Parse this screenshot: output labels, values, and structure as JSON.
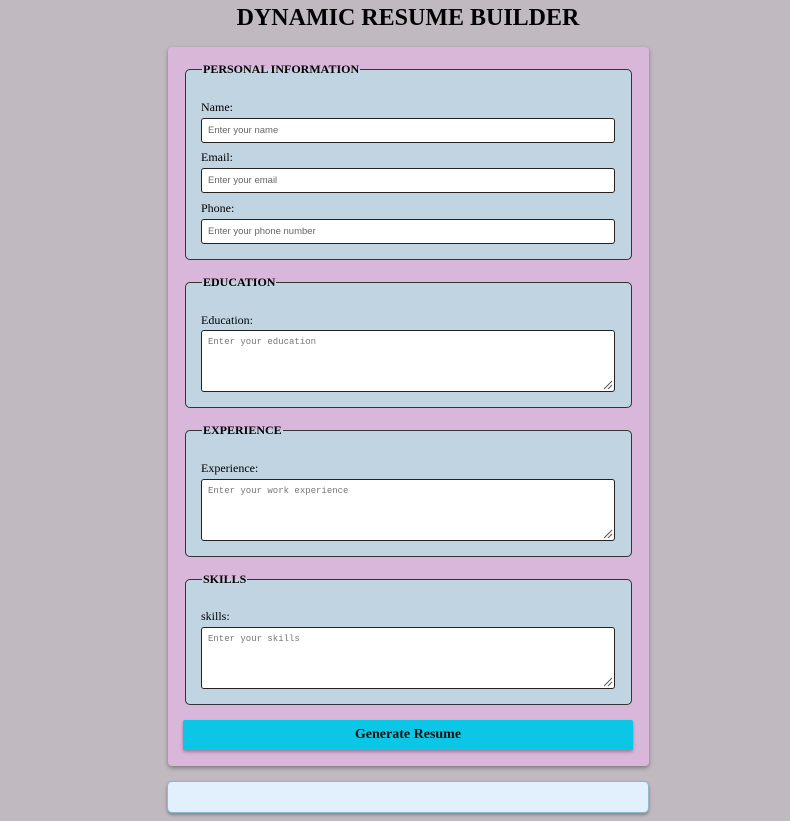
{
  "page": {
    "title": "DYNAMIC RESUME BUILDER"
  },
  "sections": {
    "personal": {
      "legend": "PERSONAL INFORMATION",
      "name_label": "Name:",
      "name_placeholder": "Enter your name",
      "email_label": "Email:",
      "email_placeholder": "Enter your email",
      "phone_label": "Phone:",
      "phone_placeholder": "Enter your phone number"
    },
    "education": {
      "legend": "EDUCATION",
      "label": "Education:",
      "placeholder": "Enter your education"
    },
    "experience": {
      "legend": "EXPERIENCE",
      "label": "Experience:",
      "placeholder": "Enter your work experience"
    },
    "skills": {
      "legend": "SKILLS",
      "label": "skills:",
      "placeholder": "Enter your skills"
    }
  },
  "actions": {
    "generate_label": "Generate Resume"
  },
  "colors": {
    "page_background": "#c0b9bf",
    "form_background": "#d9b7da",
    "section_background": "#c1d4e2",
    "button_background": "#0cc6e6",
    "output_background": "#e2f0fd"
  },
  "icons": {
    "resize_grip": "resize-grip-icon"
  }
}
